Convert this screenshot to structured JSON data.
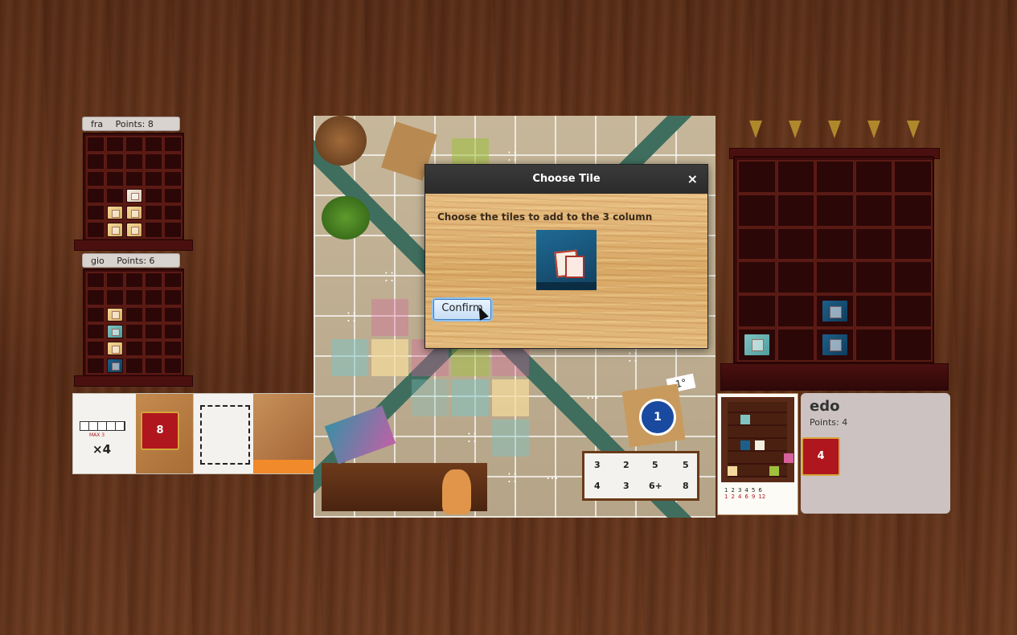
{
  "players": [
    {
      "name": "fra",
      "points_label": "Points: 8"
    },
    {
      "name": "gio",
      "points_label": "Points: 6"
    }
  ],
  "current_player": {
    "name": "edo",
    "points_label": "Points: 4",
    "scoring_token": "4"
  },
  "dialog": {
    "title": "Choose Tile",
    "close": "×",
    "message": "Choose the tiles to add to the 3 column",
    "confirm_label": "Confirm"
  },
  "common_goals": [
    {
      "token": "8",
      "text": "×4",
      "hint": "MAX 3"
    }
  ],
  "end_token": "1°",
  "board_token": "1",
  "scoring_rules": [
    "3",
    "2",
    "5",
    "5",
    "4",
    "3",
    "6+",
    "8"
  ],
  "personal_goal_table": {
    "counts": [
      "1",
      "2",
      "3",
      "4",
      "5",
      "6"
    ],
    "points": [
      "1",
      "2",
      "4",
      "6",
      "9",
      "12"
    ]
  },
  "icons": {
    "column_arrow": "down-arrow-icon",
    "rosette": "rosette-icon"
  },
  "colors": {
    "table_wood": "#5f3219",
    "shelf": "#3b0c0c",
    "dialog_title": "#2b2b2b",
    "tile_blue": "#1c5f8a",
    "tile_teal": "#7fc3c2",
    "tile_cream": "#f3d99b",
    "token_red": "#b0161d"
  }
}
